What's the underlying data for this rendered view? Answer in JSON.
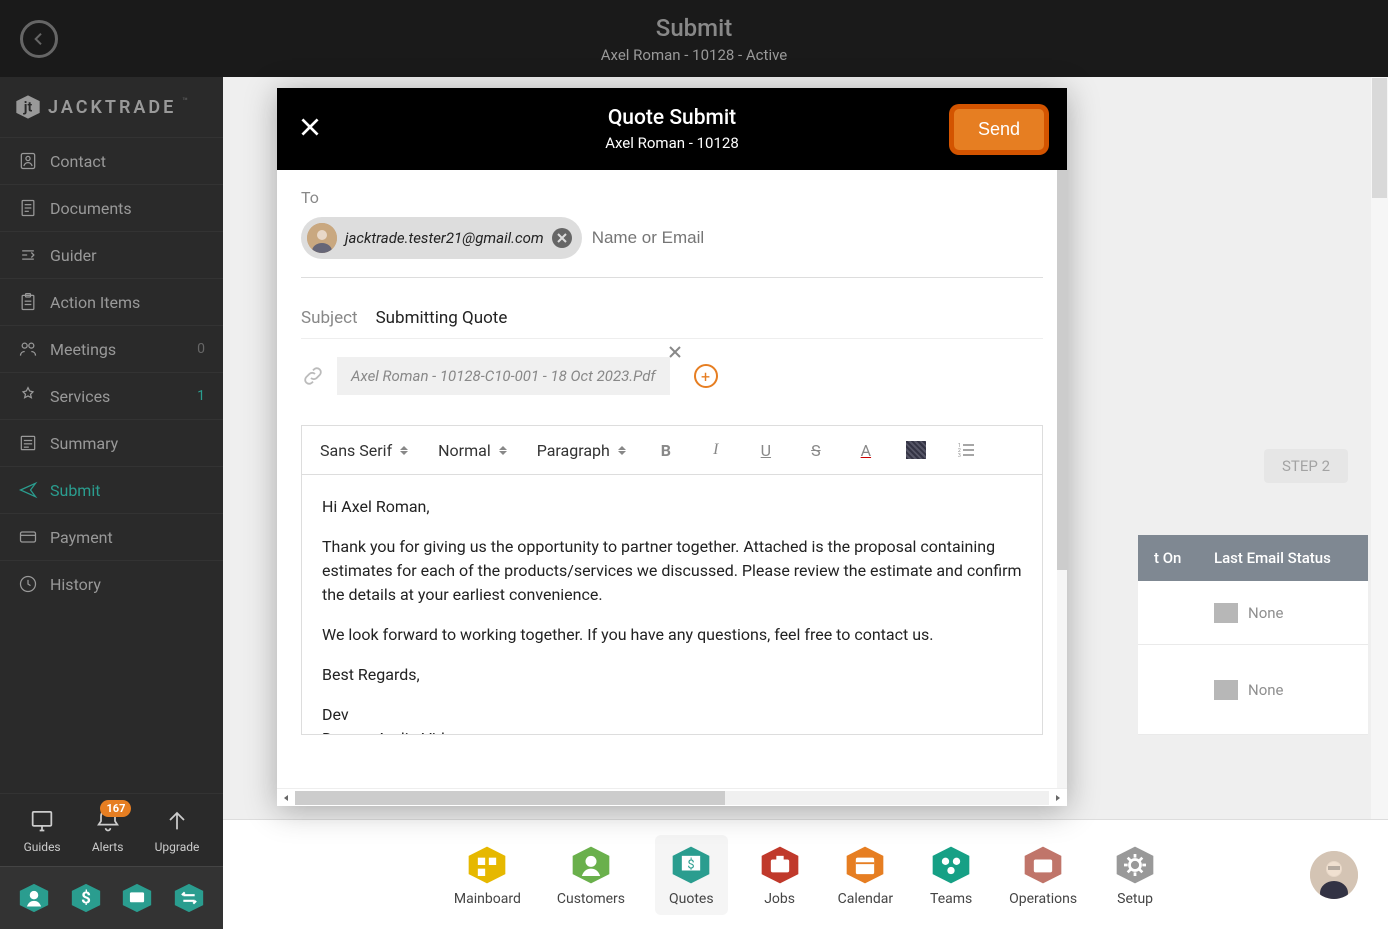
{
  "top": {
    "title": "Submit",
    "subtitle": "Axel Roman - 10128 - Active"
  },
  "logo": "JACKTRADE",
  "sidebar": {
    "items": [
      {
        "label": "Contact"
      },
      {
        "label": "Documents"
      },
      {
        "label": "Guider"
      },
      {
        "label": "Action Items"
      },
      {
        "label": "Meetings",
        "badge": "0"
      },
      {
        "label": "Services",
        "badge": "1",
        "badgeAccent": true
      },
      {
        "label": "Summary"
      },
      {
        "label": "Submit",
        "active": true
      },
      {
        "label": "Payment"
      },
      {
        "label": "History"
      }
    ],
    "bottom": {
      "guides": "Guides",
      "alerts": "Alerts",
      "alertsCount": "167",
      "upgrade": "Upgrade"
    }
  },
  "step": "STEP 2",
  "bgTable": {
    "headers": {
      "on": "t On",
      "status": "Last Email Status"
    },
    "none": "None"
  },
  "bottomNav": {
    "items": [
      {
        "label": "Mainboard",
        "color": "#e6b800"
      },
      {
        "label": "Customers",
        "color": "#6ab04c"
      },
      {
        "label": "Quotes",
        "color": "#2a9d8f",
        "active": true
      },
      {
        "label": "Jobs",
        "color": "#c0392b"
      },
      {
        "label": "Calendar",
        "color": "#e67e22"
      },
      {
        "label": "Teams",
        "color": "#16a085"
      },
      {
        "label": "Operations",
        "color": "#c0756a"
      },
      {
        "label": "Setup",
        "color": "#999"
      }
    ]
  },
  "modal": {
    "title": "Quote Submit",
    "subtitle": "Axel Roman - 10128",
    "send": "Send",
    "toLabel": "To",
    "recipient": "jacktrade.tester21@gmail.com",
    "toPlaceholder": "Name or Email",
    "subjectLabel": "Subject",
    "subjectValue": "Submitting Quote",
    "attachment": "Axel Roman - 10128-C10-001 - 18 Oct 2023.Pdf",
    "toolbar": {
      "font": "Sans Serif",
      "size": "Normal",
      "format": "Paragraph",
      "bold": "B",
      "italic": "I",
      "underline": "U",
      "strike": "S",
      "colorA": "A"
    },
    "body": {
      "greeting": "Hi Axel Roman,",
      "para1": "Thank you for giving us the opportunity to partner together. Attached is the proposal containing estimates for each of the products/services we discussed. Please review the estimate and confirm the details at your earliest convenience.",
      "para2": "We look forward to working together. If you have any questions, feel free to contact us.",
      "regards": "Best Regards,",
      "sig1": "Dev",
      "sig2": "Demo - Audio Video"
    }
  }
}
